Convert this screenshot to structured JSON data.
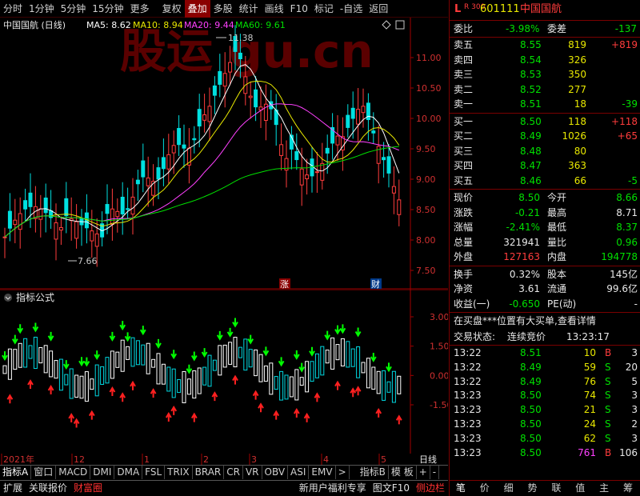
{
  "toolbar": {
    "items": [
      "分时",
      "1分钟",
      "5分钟",
      "15分钟",
      "更多",
      "复权",
      "叠加",
      "多股",
      "统计",
      "画线",
      "F10",
      "标记",
      "-自选",
      "返回"
    ],
    "active_index": 6
  },
  "chart": {
    "title": "中国国航 (日线)",
    "ma5": "MA5: 8.62",
    "ma10": "MA10: 8.94",
    "ma20": "MA20: 9.44",
    "ma60": "MA60: 9.61",
    "high_mark": "11.38",
    "low_mark": "7.66",
    "price_ticks": [
      "11.00",
      "10.50",
      "10.00",
      "9.50",
      "9.00",
      "8.50",
      "8.00",
      "7.50"
    ],
    "badge_zhang": "涨",
    "badge_cai": "财",
    "watermark": "股运 gu.cn",
    "colors": {
      "up": "#ff3c3c",
      "down": "#00e0e0",
      "ma5": "#ffffff",
      "ma10": "#e8e800",
      "ma20": "#ff40ff",
      "ma60": "#00e000"
    }
  },
  "indicator": {
    "title": "指标公式",
    "ticks": [
      "3.00",
      "1.50",
      "0.00",
      "-1.50"
    ]
  },
  "date_axis": {
    "labels": [
      "2021年",
      "12",
      "1",
      "2",
      "3",
      "4",
      "5"
    ],
    "right_label": "日线"
  },
  "tabs": {
    "items": [
      "指标A",
      "窗口",
      "MACD",
      "DMI",
      "DMA",
      "FSL",
      "TRIX",
      "BRAR",
      "CR",
      "VR",
      "OBV",
      "ASI",
      "EMV",
      ">",
      "指标B",
      "模 板",
      "+",
      "-"
    ]
  },
  "status": {
    "left": [
      "扩展",
      "关联报价",
      "财富圈"
    ],
    "right": [
      "新用户福利专享",
      "图文F10",
      "侧边栏"
    ]
  },
  "quote": {
    "header": {
      "marker": "L",
      "sub": "R 300",
      "code": "601111",
      "name": "中国国航"
    },
    "weibi_label": "委比",
    "weibi": "-3.98%",
    "weicha_label": "委差",
    "weicha": "-137",
    "asks": [
      {
        "label": "卖五",
        "price": "8.55",
        "vol": "819",
        "chg": "+819"
      },
      {
        "label": "卖四",
        "price": "8.54",
        "vol": "326",
        "chg": ""
      },
      {
        "label": "卖三",
        "price": "8.53",
        "vol": "350",
        "chg": ""
      },
      {
        "label": "卖二",
        "price": "8.52",
        "vol": "277",
        "chg": ""
      },
      {
        "label": "卖一",
        "price": "8.51",
        "vol": "18",
        "chg": "-39"
      }
    ],
    "bids": [
      {
        "label": "买一",
        "price": "8.50",
        "vol": "118",
        "chg": "+118"
      },
      {
        "label": "买二",
        "price": "8.49",
        "vol": "1026",
        "chg": "+65"
      },
      {
        "label": "买三",
        "price": "8.48",
        "vol": "80",
        "chg": ""
      },
      {
        "label": "买四",
        "price": "8.47",
        "vol": "363",
        "chg": ""
      },
      {
        "label": "买五",
        "price": "8.46",
        "vol": "66",
        "chg": "-5"
      }
    ],
    "stats": [
      {
        "l1": "现价",
        "v1": "8.50",
        "l2": "今开",
        "v2": "8.66"
      },
      {
        "l1": "涨跌",
        "v1": "-0.21",
        "l2": "最高",
        "v2": "8.71"
      },
      {
        "l1": "涨幅",
        "v1": "-2.41%",
        "l2": "最低",
        "v2": "8.37"
      },
      {
        "l1": "总量",
        "v1": "321941",
        "l2": "量比",
        "v2": "0.96"
      },
      {
        "l1": "外盘",
        "v1": "127163",
        "l2": "内盘",
        "v2": "194778"
      }
    ],
    "stats2": [
      {
        "l1": "换手",
        "v1": "0.32%",
        "l2": "股本",
        "v2": "145亿"
      },
      {
        "l1": "净资",
        "v1": "3.61",
        "l2": "流通",
        "v2": "99.6亿"
      },
      {
        "l1": "收益(一)",
        "v1": "-0.650",
        "l2": "PE(动)",
        "v2": "-"
      }
    ],
    "notice": "在买盘***位置有大买单,查看详情",
    "trade_state_label": "交易状态:",
    "trade_state": "连续竞价",
    "trade_time": "13:23:17",
    "ticks": [
      {
        "t": "13:22",
        "p": "8.51",
        "v": "10",
        "d": "B",
        "n": "3"
      },
      {
        "t": "13:22",
        "p": "8.49",
        "v": "59",
        "d": "S",
        "n": "20"
      },
      {
        "t": "13:22",
        "p": "8.49",
        "v": "76",
        "d": "S",
        "n": "5"
      },
      {
        "t": "13:23",
        "p": "8.50",
        "v": "74",
        "d": "S",
        "n": "3"
      },
      {
        "t": "13:23",
        "p": "8.50",
        "v": "21",
        "d": "S",
        "n": "3"
      },
      {
        "t": "13:23",
        "p": "8.50",
        "v": "24",
        "d": "S",
        "n": "2"
      },
      {
        "t": "13:23",
        "p": "8.50",
        "v": "62",
        "d": "S",
        "n": "3"
      },
      {
        "t": "13:23",
        "p": "8.50",
        "v": "761",
        "d": "B",
        "n": "106"
      }
    ],
    "bottom_tabs": [
      "笔",
      "价",
      "细",
      "势",
      "联",
      "值",
      "主",
      "筹"
    ]
  }
}
